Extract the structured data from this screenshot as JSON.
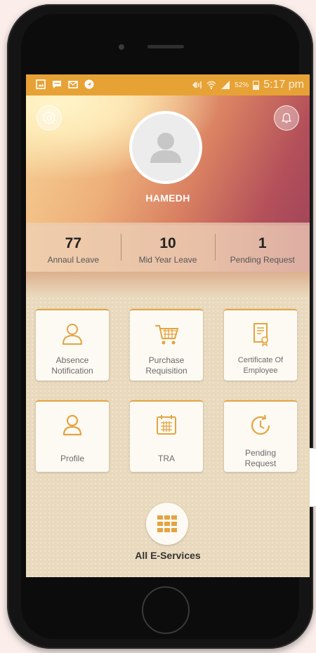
{
  "status_bar": {
    "battery": "52%",
    "time": "5:17 pm"
  },
  "profile": {
    "name": "HAMEDH"
  },
  "stats": [
    {
      "value": "77",
      "label": "Annaul Leave"
    },
    {
      "value": "10",
      "label": "Mid Year Leave"
    },
    {
      "value": "1",
      "label": "Pending Request"
    }
  ],
  "services": [
    {
      "label": "Absence Notification",
      "icon": "person-outline-icon"
    },
    {
      "label": "Purchase Requisition",
      "icon": "shopping-cart-icon"
    },
    {
      "label": "Certificate Of Employee",
      "icon": "certificate-icon"
    },
    {
      "label": "Profile",
      "icon": "person-icon"
    },
    {
      "label": "TRA",
      "icon": "calendar-icon"
    },
    {
      "label": "Pending Request",
      "icon": "clock-icon"
    }
  ],
  "all_services": {
    "label": "All E-Services",
    "icon": "grid-icon"
  },
  "colors": {
    "accent": "#e7a236",
    "status_bar": "#e7a236",
    "tile_bg": "#fdfaf4",
    "page_bg": "#e9d9bd"
  }
}
